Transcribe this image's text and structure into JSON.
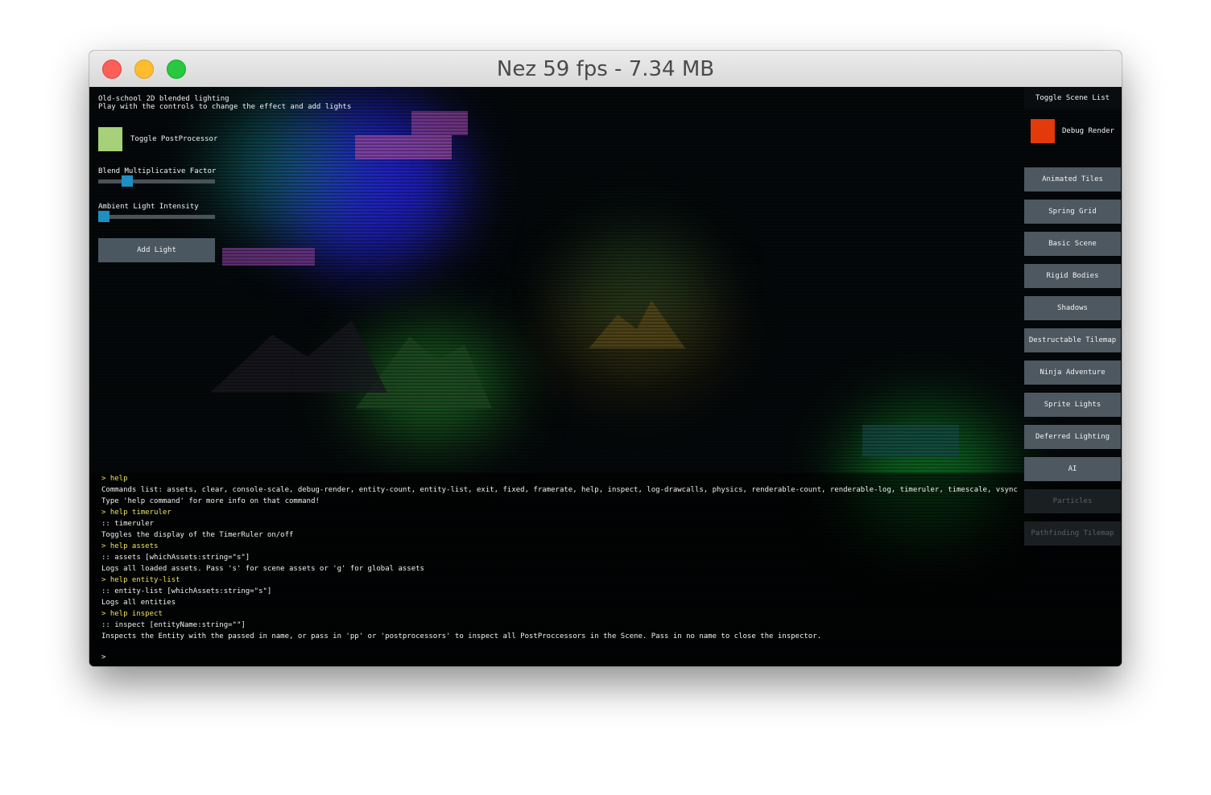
{
  "window": {
    "title": "Nez 59 fps - 7.34 MB"
  },
  "demo": {
    "info_line1": "Old-school 2D blended lighting",
    "info_line2": "Play with the controls to change the effect and add lights",
    "toggle_postprocessor_label": "Toggle PostProcessor",
    "blend_label": "Blend Multiplicative Factor",
    "blend_value_fraction": 0.22,
    "ambient_label": "Ambient Light Intensity",
    "ambient_value_fraction": 0.0,
    "add_light_label": "Add Light"
  },
  "scene_panel": {
    "toggle_label": "Toggle Scene List",
    "debug_render_label": "Debug Render",
    "debug_render_color": "#e23a0b",
    "scenes": [
      {
        "label": "Animated Tiles"
      },
      {
        "label": "Spring Grid"
      },
      {
        "label": "Basic Scene"
      },
      {
        "label": "Rigid Bodies"
      },
      {
        "label": "Shadows"
      },
      {
        "label": "Destructable Tilemap"
      },
      {
        "label": "Ninja Adventure"
      },
      {
        "label": "Sprite Lights"
      },
      {
        "label": "Deferred Lighting"
      },
      {
        "label": "AI"
      },
      {
        "label": "Particles"
      },
      {
        "label": "Pathfinding Tilemap"
      }
    ]
  },
  "console": {
    "lines": [
      {
        "text": "> help",
        "kind": "cmd"
      },
      {
        "text": "Commands list: assets, clear, console-scale, debug-render, entity-count, entity-list, exit, fixed, framerate, help, inspect, log-drawcalls, physics, renderable-count, renderable-log, timeruler, timescale, vsync",
        "kind": "out"
      },
      {
        "text": "Type 'help command' for more info on that command!",
        "kind": "out"
      },
      {
        "text": "> help timeruler",
        "kind": "cmd"
      },
      {
        "text": ":: timeruler",
        "kind": "out"
      },
      {
        "text": "Toggles the display of the TimerRuler on/off",
        "kind": "out"
      },
      {
        "text": "> help assets",
        "kind": "cmd"
      },
      {
        "text": ":: assets [whichAssets:string=\"s\"]",
        "kind": "out"
      },
      {
        "text": "Logs all loaded assets. Pass 's' for scene assets or 'g' for global assets",
        "kind": "out"
      },
      {
        "text": "> help entity-list",
        "kind": "cmd"
      },
      {
        "text": ":: entity-list [whichAssets:string=\"s\"]",
        "kind": "out"
      },
      {
        "text": "Logs all entities",
        "kind": "out"
      },
      {
        "text": "> help inspect",
        "kind": "cmd"
      },
      {
        "text": ":: inspect [entityName:string=\"\"]",
        "kind": "out"
      },
      {
        "text": "Inspects the Entity with the passed in name, or pass in 'pp' or 'postprocessors' to inspect all PostProccessors in the Scene. Pass in no name to close the inspector.",
        "kind": "out"
      }
    ],
    "prompt": ">"
  }
}
